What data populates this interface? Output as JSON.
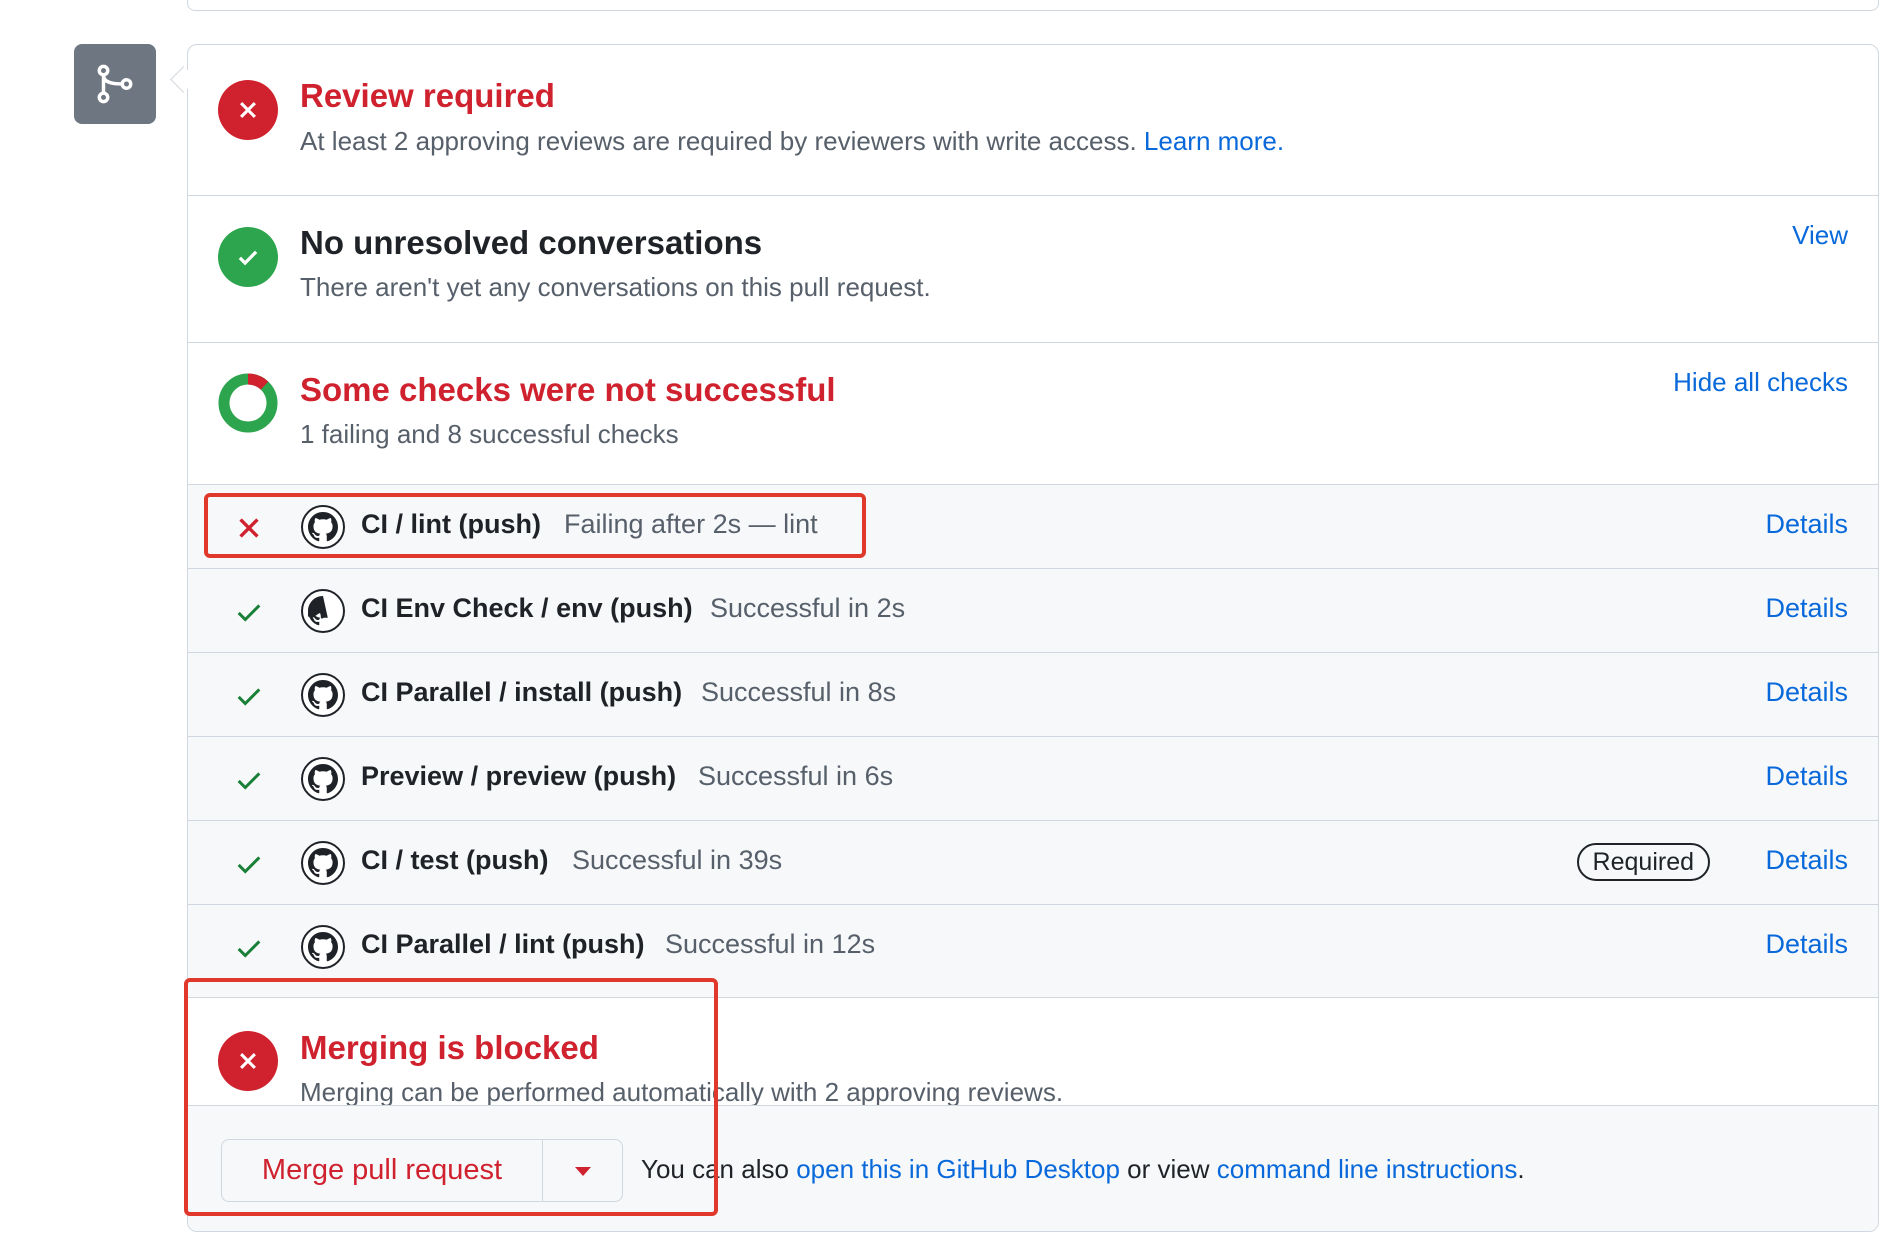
{
  "review": {
    "title": "Review required",
    "description": "At least 2 approving reviews are required by reviewers with write access.",
    "learn_more": "Learn more."
  },
  "conversations": {
    "title": "No unresolved conversations",
    "description": "There aren't yet any conversations on this pull request.",
    "view": "View"
  },
  "checks": {
    "title": "Some checks were not successful",
    "summary": "1 failing and 8 successful checks",
    "hide_all": "Hide all checks",
    "items": [
      {
        "name": "CI / lint (push)",
        "description": "Failing after 2s — lint",
        "status": "failing",
        "details": "Details"
      },
      {
        "name": "CI Env Check / env (push)",
        "description": "Successful in 2s",
        "status": "success",
        "details": "Details"
      },
      {
        "name": "CI Parallel / install (push)",
        "description": "Successful in 8s",
        "status": "success",
        "details": "Details"
      },
      {
        "name": "Preview / preview (push)",
        "description": "Successful in 6s",
        "status": "success",
        "details": "Details"
      },
      {
        "name": "CI / test (push)",
        "description": "Successful in 39s",
        "status": "success",
        "badge": "Required",
        "details": "Details"
      },
      {
        "name": "CI Parallel / lint (push)",
        "description": "Successful in 12s",
        "status": "success",
        "details": "Details"
      }
    ]
  },
  "merging": {
    "title": "Merging is blocked",
    "description": "Merging can be performed automatically with 2 approving reviews."
  },
  "footer": {
    "merge_button": "Merge pull request",
    "text_prefix": "You can also",
    "desktop_link": "open this in GitHub Desktop",
    "text_middle": "or view",
    "cli_link": "command line instructions",
    "text_suffix": "."
  },
  "colors": {
    "danger": "#cf222e",
    "success": "#2da44e",
    "link": "#0969da",
    "highlight": "#e0392b"
  }
}
